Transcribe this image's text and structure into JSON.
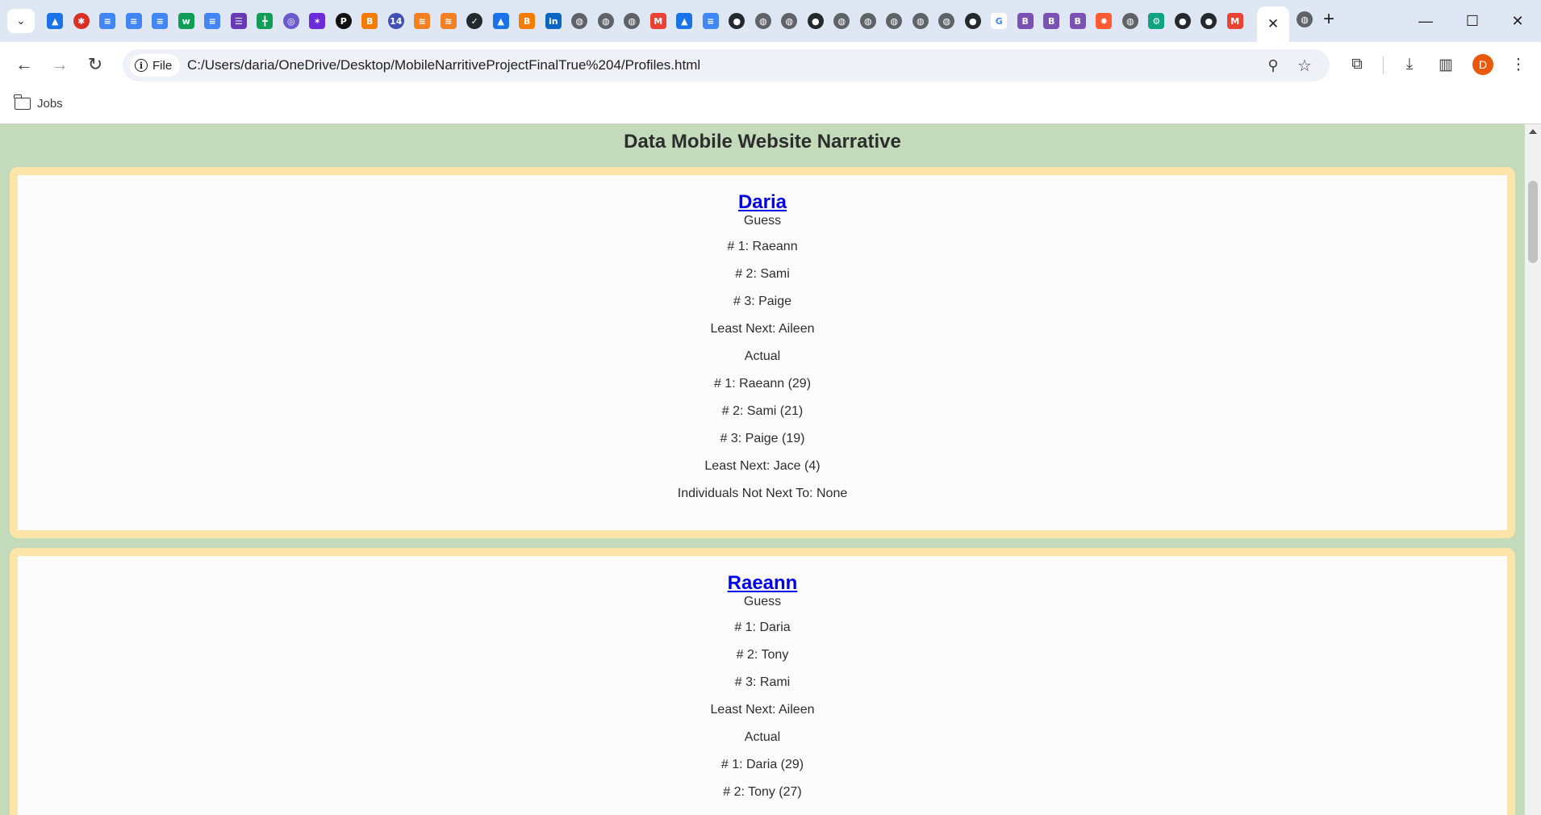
{
  "browser": {
    "tab_favicons": [
      {
        "icon": "google-drive-icon",
        "color": "#1a73e8",
        "glyph": "▲"
      },
      {
        "icon": "red-circle-icon",
        "color": "#d93025",
        "glyph": "✱"
      },
      {
        "icon": "google-docs-icon",
        "color": "#4285f4",
        "glyph": "≡"
      },
      {
        "icon": "google-docs-icon",
        "color": "#4285f4",
        "glyph": "≡"
      },
      {
        "icon": "google-docs-icon",
        "color": "#4285f4",
        "glyph": "≡"
      },
      {
        "icon": "w-logo-icon",
        "color": "#0f9d58",
        "glyph": "w"
      },
      {
        "icon": "google-docs-icon",
        "color": "#4285f4",
        "glyph": "≡"
      },
      {
        "icon": "google-forms-icon",
        "color": "#673ab7",
        "glyph": "☰"
      },
      {
        "icon": "google-sheets-icon",
        "color": "#0f9d58",
        "glyph": "╋"
      },
      {
        "icon": "purple-circle-icon",
        "color": "#6a5acd",
        "glyph": "◎"
      },
      {
        "icon": "sparkle-icon",
        "color": "#6c2bd9",
        "glyph": "✶"
      },
      {
        "icon": "black-p-icon",
        "color": "#111111",
        "glyph": "P"
      },
      {
        "icon": "blogger-b-icon",
        "color": "#f57c00",
        "glyph": "B"
      },
      {
        "icon": "notification-14-icon",
        "color": "#3f51b5",
        "glyph": "14"
      },
      {
        "icon": "stackoverflow-icon",
        "color": "#f48024",
        "glyph": "≋"
      },
      {
        "icon": "stackoverflow-icon",
        "color": "#f48024",
        "glyph": "≋"
      },
      {
        "icon": "github-check-icon",
        "color": "#24292e",
        "glyph": "✓"
      },
      {
        "icon": "google-drive-icon",
        "color": "#1a73e8",
        "glyph": "▲"
      },
      {
        "icon": "blogger-b-icon",
        "color": "#f57c00",
        "glyph": "B"
      },
      {
        "icon": "linkedin-icon",
        "color": "#0a66c2",
        "glyph": "in"
      },
      {
        "icon": "globe-icon",
        "color": "#5f6368",
        "glyph": "◍"
      },
      {
        "icon": "globe-icon",
        "color": "#5f6368",
        "glyph": "◍"
      },
      {
        "icon": "globe-icon",
        "color": "#5f6368",
        "glyph": "◍"
      },
      {
        "icon": "gmail-icon",
        "color": "#ea4335",
        "glyph": "M"
      },
      {
        "icon": "google-drive-icon",
        "color": "#1a73e8",
        "glyph": "▲"
      },
      {
        "icon": "google-docs-icon",
        "color": "#4285f4",
        "glyph": "≡"
      },
      {
        "icon": "github-icon",
        "color": "#24292e",
        "glyph": "●"
      },
      {
        "icon": "globe-icon",
        "color": "#5f6368",
        "glyph": "◍"
      },
      {
        "icon": "globe-icon",
        "color": "#5f6368",
        "glyph": "◍"
      },
      {
        "icon": "github-icon",
        "color": "#24292e",
        "glyph": "●"
      },
      {
        "icon": "globe-icon",
        "color": "#5f6368",
        "glyph": "◍"
      },
      {
        "icon": "globe-icon",
        "color": "#5f6368",
        "glyph": "◍"
      },
      {
        "icon": "globe-icon",
        "color": "#5f6368",
        "glyph": "◍"
      },
      {
        "icon": "globe-icon",
        "color": "#5f6368",
        "glyph": "◍"
      },
      {
        "icon": "globe-icon",
        "color": "#5f6368",
        "glyph": "◍"
      },
      {
        "icon": "github-icon",
        "color": "#24292e",
        "glyph": "●"
      },
      {
        "icon": "google-g-icon",
        "color": "#4285f4",
        "glyph": "G"
      },
      {
        "icon": "bootstrap-icon",
        "color": "#7952b3",
        "glyph": "B"
      },
      {
        "icon": "bootstrap-icon",
        "color": "#7952b3",
        "glyph": "B"
      },
      {
        "icon": "bootstrap-icon",
        "color": "#7952b3",
        "glyph": "B"
      },
      {
        "icon": "hubspot-icon",
        "color": "#ff5c35",
        "glyph": "✸"
      },
      {
        "icon": "globe-icon",
        "color": "#5f6368",
        "glyph": "◍"
      },
      {
        "icon": "chatgpt-icon",
        "color": "#10a37f",
        "glyph": "⚙"
      },
      {
        "icon": "github-icon",
        "color": "#24292e",
        "glyph": "●"
      },
      {
        "icon": "github-icon",
        "color": "#24292e",
        "glyph": "●"
      },
      {
        "icon": "gmail-icon",
        "color": "#ea4335",
        "glyph": "M"
      }
    ],
    "chip_label": "File",
    "url": "C:/Users/daria/OneDrive/Desktop/MobileNarritiveProjectFinalTrue%204/Profiles.html",
    "avatar_letter": "D",
    "bookmark_label": "Jobs"
  },
  "page": {
    "title": "Data Mobile Website Narrative",
    "profiles": [
      {
        "name": "Daria",
        "guess_heading": "Guess",
        "guess": [
          "# 1: Raeann",
          "# 2: Sami",
          "# 3: Paige",
          "Least Next: Aileen"
        ],
        "actual_heading": "Actual",
        "actual": [
          "# 1: Raeann (29)",
          "# 2: Sami (21)",
          "# 3: Paige (19)",
          "Least Next: Jace (4)",
          "Individuals Not Next To: None"
        ]
      },
      {
        "name": "Raeann",
        "guess_heading": "Guess",
        "guess": [
          "# 1: Daria",
          "# 2: Tony",
          "# 3: Rami",
          "Least Next: Aileen"
        ],
        "actual_heading": "Actual",
        "actual": [
          "# 1: Daria (29)",
          "# 2: Tony (27)"
        ]
      }
    ]
  },
  "colors": {
    "page_background": "#c3dbbb",
    "card_border": "#fde4a9",
    "card_background": "#fcfcfc",
    "link": "#0000ee"
  }
}
